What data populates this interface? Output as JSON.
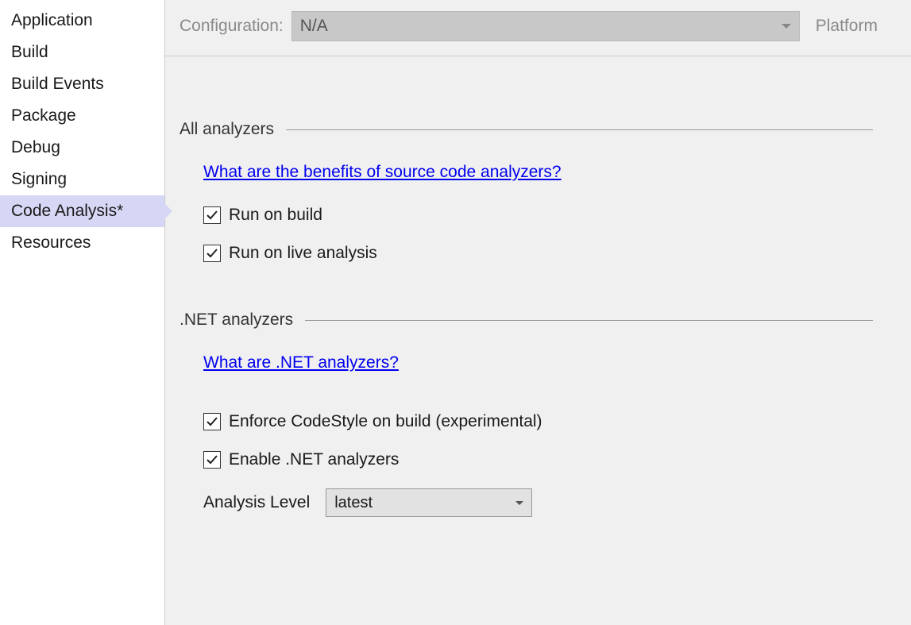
{
  "sidebar": {
    "items": [
      {
        "label": "Application",
        "active": false
      },
      {
        "label": "Build",
        "active": false
      },
      {
        "label": "Build Events",
        "active": false
      },
      {
        "label": "Package",
        "active": false
      },
      {
        "label": "Debug",
        "active": false
      },
      {
        "label": "Signing",
        "active": false
      },
      {
        "label": "Code Analysis*",
        "active": true
      },
      {
        "label": "Resources",
        "active": false
      }
    ]
  },
  "topbar": {
    "configuration_label": "Configuration:",
    "configuration_value": "N/A",
    "platform_label": "Platform"
  },
  "sections": {
    "all_analyzers": {
      "title": "All analyzers",
      "link": "What are the benefits of source code analyzers?",
      "checkboxes": [
        {
          "label": "Run on build",
          "checked": true
        },
        {
          "label": "Run on live analysis",
          "checked": true
        }
      ]
    },
    "net_analyzers": {
      "title": ".NET analyzers",
      "link": "What are .NET analyzers?",
      "checkboxes": [
        {
          "label": "Enforce CodeStyle on build (experimental)",
          "checked": true
        },
        {
          "label": "Enable .NET analyzers",
          "checked": true
        }
      ],
      "analysis_level_label": "Analysis Level",
      "analysis_level_value": "latest"
    }
  }
}
